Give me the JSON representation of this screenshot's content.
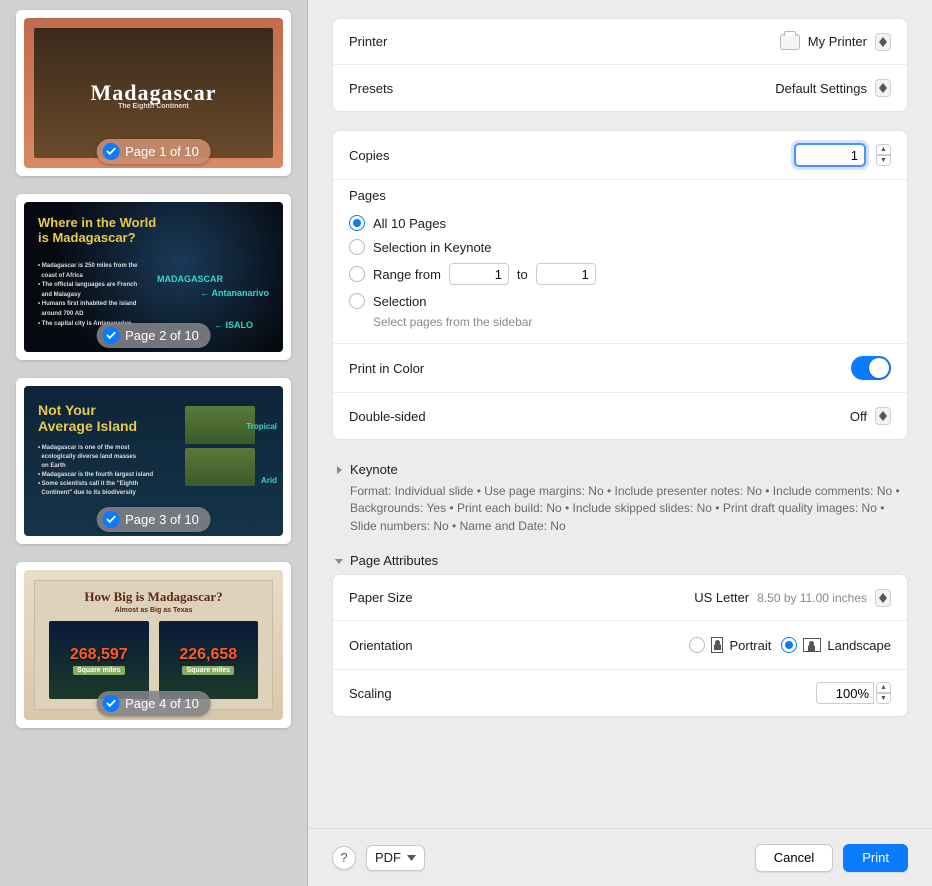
{
  "sidebar": {
    "thumbs": [
      {
        "badge": "Page 1 of 10",
        "title": "Madagascar",
        "subtitle": "The Eighth Continent"
      },
      {
        "badge": "Page 2 of 10",
        "title": "Where in the World is Madagascar?",
        "labels": [
          "MADAGASCAR",
          "Antananarivo",
          "ISALO"
        ],
        "bullets": [
          "Madagascar is 250 miles from the coast of Africa",
          "The official languages are French and Malagasy",
          "Humans first inhabited the island around 700 AD",
          "The capital city is Antananarivo"
        ]
      },
      {
        "badge": "Page 3 of 10",
        "title": "Not Your Average Island",
        "annotations": [
          "Tropical",
          "Arid"
        ],
        "bullets": [
          "Madagascar is one of the most ecologically diverse land masses on Earth",
          "Madagascar is the fourth largest island",
          "Some scientists call it the \"Eighth Continent\" due to its biodiversity"
        ]
      },
      {
        "badge": "Page 4 of 10",
        "title": "How Big is Madagascar?",
        "subtitle": "Almost as Big as Texas",
        "values": [
          "268,597",
          "226,658"
        ],
        "unit": "Square miles"
      }
    ]
  },
  "printer": {
    "label": "Printer",
    "value": "My Printer"
  },
  "presets": {
    "label": "Presets",
    "value": "Default Settings"
  },
  "copies": {
    "label": "Copies",
    "value": "1"
  },
  "pages": {
    "heading": "Pages",
    "all": "All 10 Pages",
    "selection_app": "Selection in Keynote",
    "range_label": "Range from",
    "range_from": "1",
    "range_to_label": "to",
    "range_to": "1",
    "selection": "Selection",
    "selection_hint": "Select pages from the sidebar"
  },
  "color": {
    "label": "Print in Color",
    "on": true
  },
  "doublesided": {
    "label": "Double-sided",
    "value": "Off"
  },
  "keynote": {
    "heading": "Keynote",
    "summary": "Format: Individual slide • Use page margins: No • Include presenter notes: No • Include comments: No • Backgrounds: Yes • Print each build: No • Include skipped slides: No • Print draft quality images: No • Slide numbers: No • Name and Date: No"
  },
  "page_attrs": {
    "heading": "Page Attributes",
    "paper_label": "Paper Size",
    "paper_value": "US Letter",
    "paper_dims": "8.50 by 11.00 inches",
    "orientation_label": "Orientation",
    "portrait": "Portrait",
    "landscape": "Landscape",
    "scaling_label": "Scaling",
    "scaling_value": "100%"
  },
  "footer": {
    "help": "?",
    "pdf": "PDF",
    "cancel": "Cancel",
    "print": "Print"
  }
}
